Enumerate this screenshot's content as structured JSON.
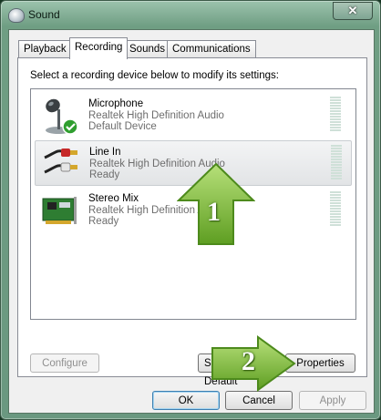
{
  "window": {
    "title": "Sound",
    "close_glyph": "✕"
  },
  "tabs": [
    {
      "label": "Playback",
      "active": false
    },
    {
      "label": "Recording",
      "active": true
    },
    {
      "label": "Sounds",
      "active": false
    },
    {
      "label": "Communications",
      "active": false
    }
  ],
  "panel": {
    "instruction": "Select a recording device below to modify its settings:"
  },
  "devices": [
    {
      "name": "Microphone",
      "driver": "Realtek High Definition Audio",
      "status": "Default Device",
      "icon": "microphone-icon",
      "default_badge": "check-icon"
    },
    {
      "name": "Line In",
      "driver": "Realtek High Definition Audio",
      "status": "Ready",
      "icon": "rca-cable-icon",
      "selected": true
    },
    {
      "name": "Stereo Mix",
      "driver": "Realtek High Definition Audio",
      "status": "Ready",
      "icon": "sound-card-icon"
    }
  ],
  "panel_buttons": {
    "configure": "Configure",
    "set_default": "Set Default",
    "properties": "Properties"
  },
  "dialog_buttons": {
    "ok": "OK",
    "cancel": "Cancel",
    "apply": "Apply"
  },
  "annotations": {
    "arrow1": "1",
    "arrow2": "2"
  },
  "colors": {
    "arrow_green": "#8cc63f",
    "arrow_green_dark": "#4d8a1c",
    "check_green": "#2f9e2f"
  }
}
